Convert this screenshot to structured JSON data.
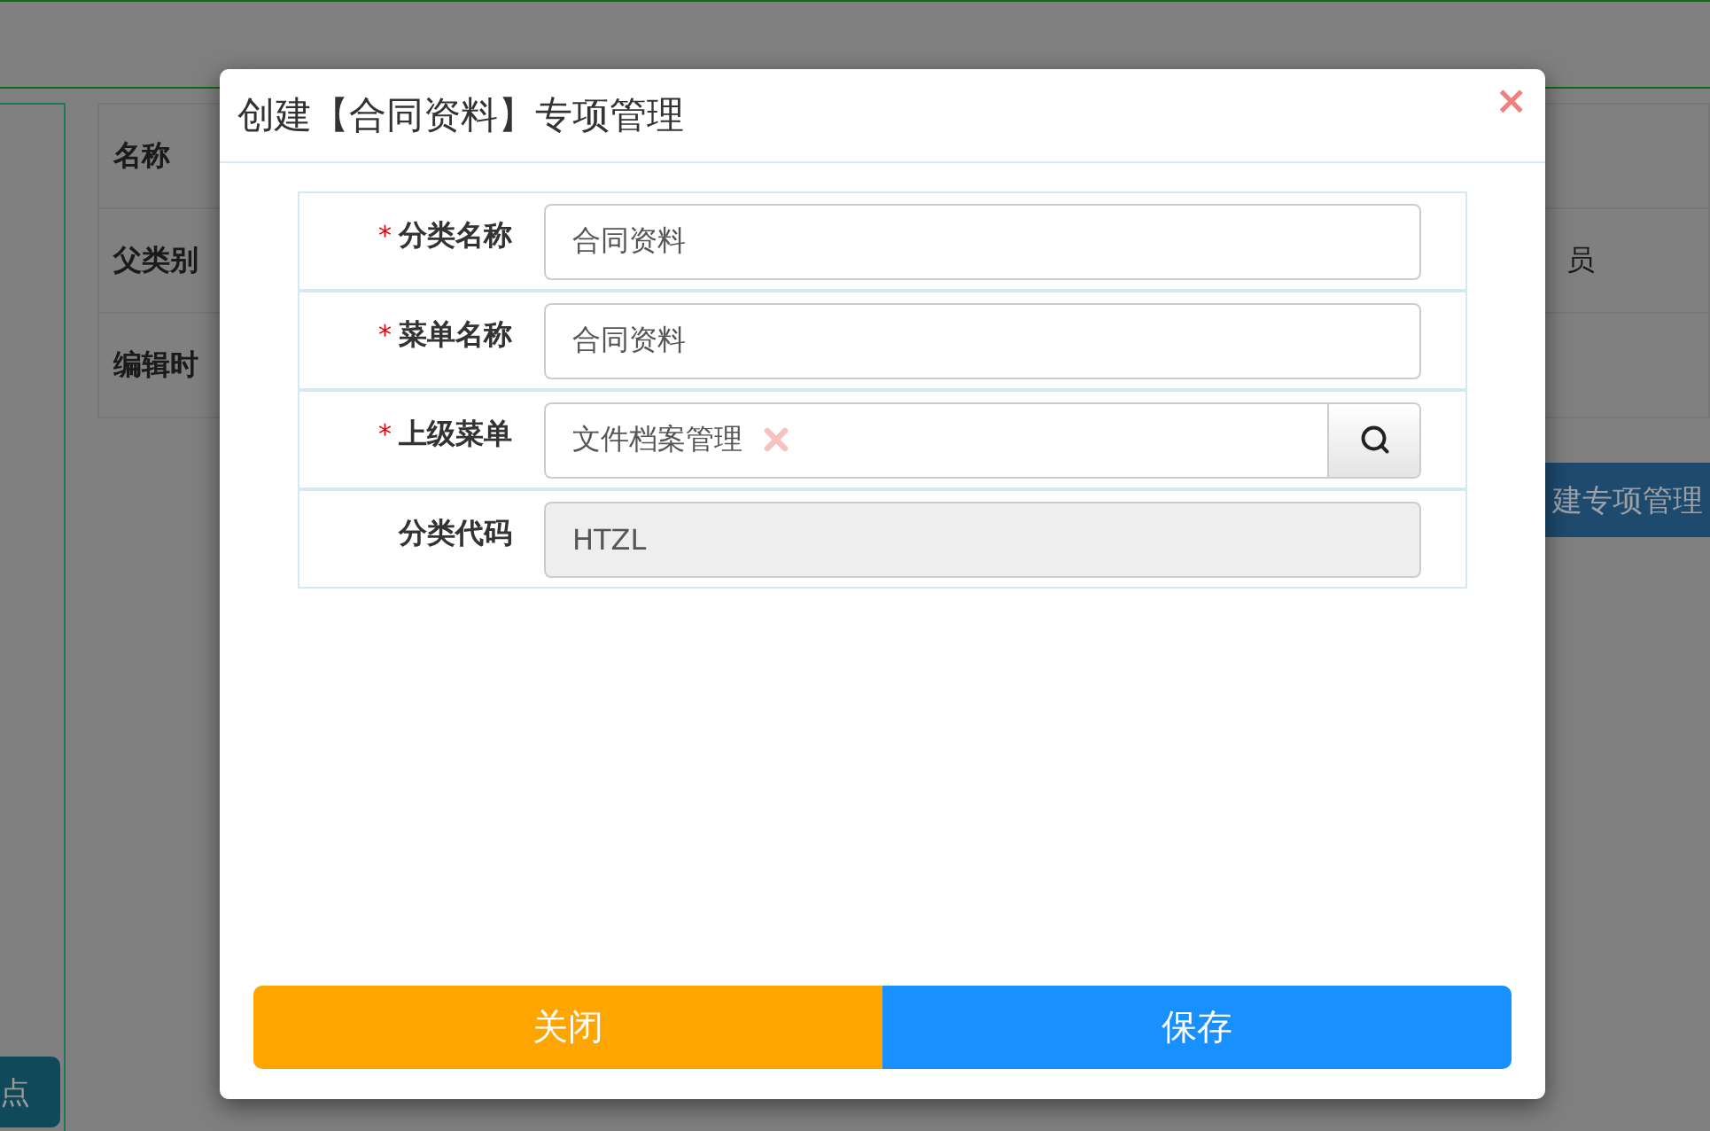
{
  "page": {
    "table_rows": [
      {
        "label": "名称"
      },
      {
        "label": "父类别",
        "value": "员"
      },
      {
        "label": "编辑时"
      }
    ],
    "create_button": "建专项管理",
    "left_button": "点"
  },
  "dialog": {
    "title": "创建【合同资料】专项管理",
    "close": "×",
    "required_mark": "*",
    "fields": [
      {
        "label": "分类名称",
        "required": true,
        "kind": "text",
        "value": "合同资料"
      },
      {
        "label": "菜单名称",
        "required": true,
        "kind": "text",
        "value": "合同资料"
      },
      {
        "label": "上级菜单",
        "required": true,
        "kind": "lookup",
        "value": "文件档案管理"
      },
      {
        "label": "分类代码",
        "required": false,
        "kind": "readonly",
        "value": "HTZL"
      }
    ],
    "buttons": [
      {
        "label": "关闭",
        "kind": "close"
      },
      {
        "label": "保存",
        "kind": "save"
      }
    ]
  }
}
